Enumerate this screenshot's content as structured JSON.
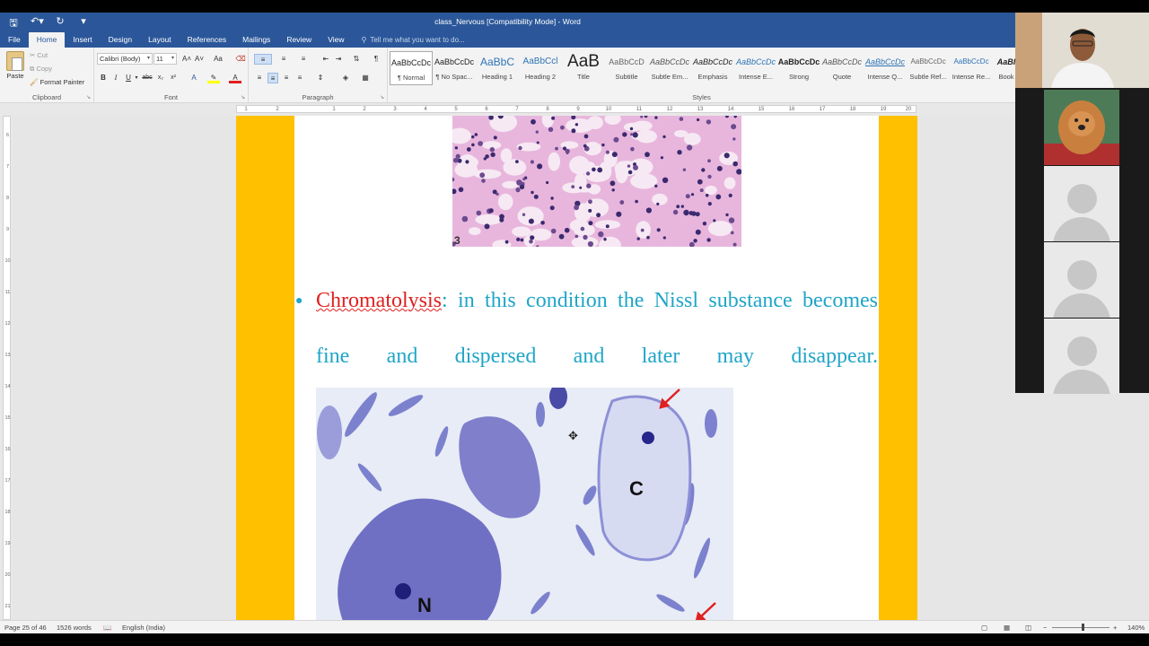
{
  "window": {
    "title": "class_Nervous [Compatibility Mode] - Word"
  },
  "qat": {
    "save_icon": "save-icon",
    "undo_icon": "undo-icon",
    "redo_icon": "redo-icon",
    "customize_icon": "customize-icon"
  },
  "tabs": [
    "File",
    "Home",
    "Insert",
    "Design",
    "Layout",
    "References",
    "Mailings",
    "Review",
    "View"
  ],
  "active_tab": "Home",
  "tell_me": "Tell me what you want to do...",
  "clipboard": {
    "paste": "Paste",
    "cut": "Cut",
    "copy": "Copy",
    "format_painter": "Format Painter",
    "label": "Clipboard"
  },
  "font": {
    "name": "Calibri (Body)",
    "size": "11",
    "grow": "A˄",
    "shrink": "A˅",
    "case": "Aa",
    "label": "Font"
  },
  "paragraph": {
    "label": "Paragraph",
    "pilcrow": "¶"
  },
  "styles": {
    "label": "Styles",
    "items": [
      {
        "preview": "AaBbCcDc",
        "name": "¶ Normal"
      },
      {
        "preview": "AaBbCcDc",
        "name": "¶ No Spac..."
      },
      {
        "preview": "AaBbC",
        "name": "Heading 1"
      },
      {
        "preview": "AaBbCcl",
        "name": "Heading 2"
      },
      {
        "preview": "AaB",
        "name": "Title"
      },
      {
        "preview": "AaBbCcD",
        "name": "Subtitle"
      },
      {
        "preview": "AaBbCcDc",
        "name": "Subtle Em..."
      },
      {
        "preview": "AaBbCcDc",
        "name": "Emphasis"
      },
      {
        "preview": "AaBbCcDc",
        "name": "Intense E..."
      },
      {
        "preview": "AaBbCcDc",
        "name": "Strong"
      },
      {
        "preview": "AaBbCcDc",
        "name": "Quote"
      },
      {
        "preview": "AaBbCcDc",
        "name": "Intense Q..."
      },
      {
        "preview": "AaBbCcDc",
        "name": "Subtle Ref..."
      },
      {
        "preview": "AaBbCcDc",
        "name": "Intense Re..."
      },
      {
        "preview": "AaBl",
        "name": "Book"
      }
    ]
  },
  "ruler": {
    "marks": [
      "1",
      "2",
      "1",
      "2",
      "3",
      "4",
      "5",
      "6",
      "7",
      "8",
      "9",
      "10",
      "11",
      "12",
      "13",
      "14",
      "15",
      "16",
      "17",
      "18",
      "19",
      "20"
    ]
  },
  "vruler": {
    "marks": [
      "6",
      "7",
      "8",
      "9",
      "10",
      "11",
      "12",
      "13",
      "14",
      "15",
      "16",
      "17",
      "18",
      "19",
      "20",
      "21"
    ]
  },
  "document": {
    "image1_label": "3",
    "para_term": "Chromatolysis",
    "para_text": ": in this condition the Nissl substance becomes fine and dispersed and later may disappear.",
    "image2_labels": {
      "c": "C",
      "n": "N"
    }
  },
  "status": {
    "page": "Page 25 of 46",
    "words": "1526 words",
    "language": "English (India)",
    "zoom": "140%"
  },
  "colors": {
    "word_blue": "#2b579a",
    "band": "#ffc000",
    "text_cyan": "#1fa5c8",
    "term_red": "#e02020"
  }
}
